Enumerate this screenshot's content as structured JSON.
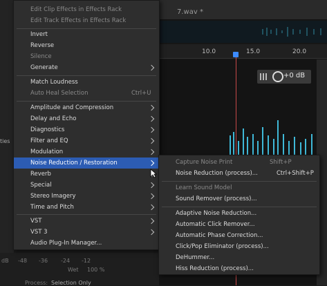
{
  "editor": {
    "tab_filename": "7.wav *",
    "ruler_ticks": [
      "10.0",
      "15.0",
      "20.0"
    ],
    "hud_value": "+0 dB"
  },
  "left_panel": {
    "tiles_label": "ties",
    "db_scale": [
      "dB",
      "-48",
      "-36",
      "-24",
      "-12"
    ],
    "wet_label": "Wet",
    "wet_value": "100 %",
    "process_label": "Process:",
    "process_value": "Selection Only"
  },
  "menu": {
    "items": [
      {
        "label": "Edit Clip Effects in Effects Rack",
        "disabled": true
      },
      {
        "label": "Edit Track Effects in Effects Rack",
        "disabled": true
      },
      {
        "label": "Invert"
      },
      {
        "label": "Reverse"
      },
      {
        "label": "Silence",
        "disabled": true
      },
      {
        "label": "Generate",
        "submenu": true
      },
      {
        "label": "Match Loudness"
      },
      {
        "label": "Auto Heal Selection",
        "disabled": true,
        "shortcut": "Ctrl+U"
      },
      {
        "label": "Amplitude and Compression",
        "submenu": true
      },
      {
        "label": "Delay and Echo",
        "submenu": true
      },
      {
        "label": "Diagnostics",
        "submenu": true
      },
      {
        "label": "Filter and EQ",
        "submenu": true
      },
      {
        "label": "Modulation",
        "submenu": true
      },
      {
        "label": "Noise Reduction / Restoration",
        "submenu": true,
        "highlighted": true
      },
      {
        "label": "Reverb",
        "submenu": true
      },
      {
        "label": "Special",
        "submenu": true
      },
      {
        "label": "Stereo Imagery",
        "submenu": true
      },
      {
        "label": "Time and Pitch",
        "submenu": true
      },
      {
        "label": "VST",
        "submenu": true
      },
      {
        "label": "VST 3",
        "submenu": true
      },
      {
        "label": "Audio Plug-In Manager..."
      }
    ]
  },
  "submenu": {
    "items": [
      {
        "label": "Capture Noise Print",
        "disabled": true,
        "shortcut": "Shift+P"
      },
      {
        "label": "Noise Reduction (process)...",
        "shortcut": "Ctrl+Shift+P"
      },
      {
        "label": "Learn Sound Model",
        "disabled": true
      },
      {
        "label": "Sound Remover (process)..."
      },
      {
        "label": "Adaptive Noise Reduction..."
      },
      {
        "label": "Automatic Click Remover..."
      },
      {
        "label": "Automatic Phase Correction..."
      },
      {
        "label": "Click/Pop Eliminator (process)..."
      },
      {
        "label": "DeHummer..."
      },
      {
        "label": "Hiss Reduction (process)..."
      }
    ]
  },
  "colors": {
    "highlight": "#2c5cb3",
    "waveform": "#3fb9d8",
    "playhead": "#c84848"
  }
}
